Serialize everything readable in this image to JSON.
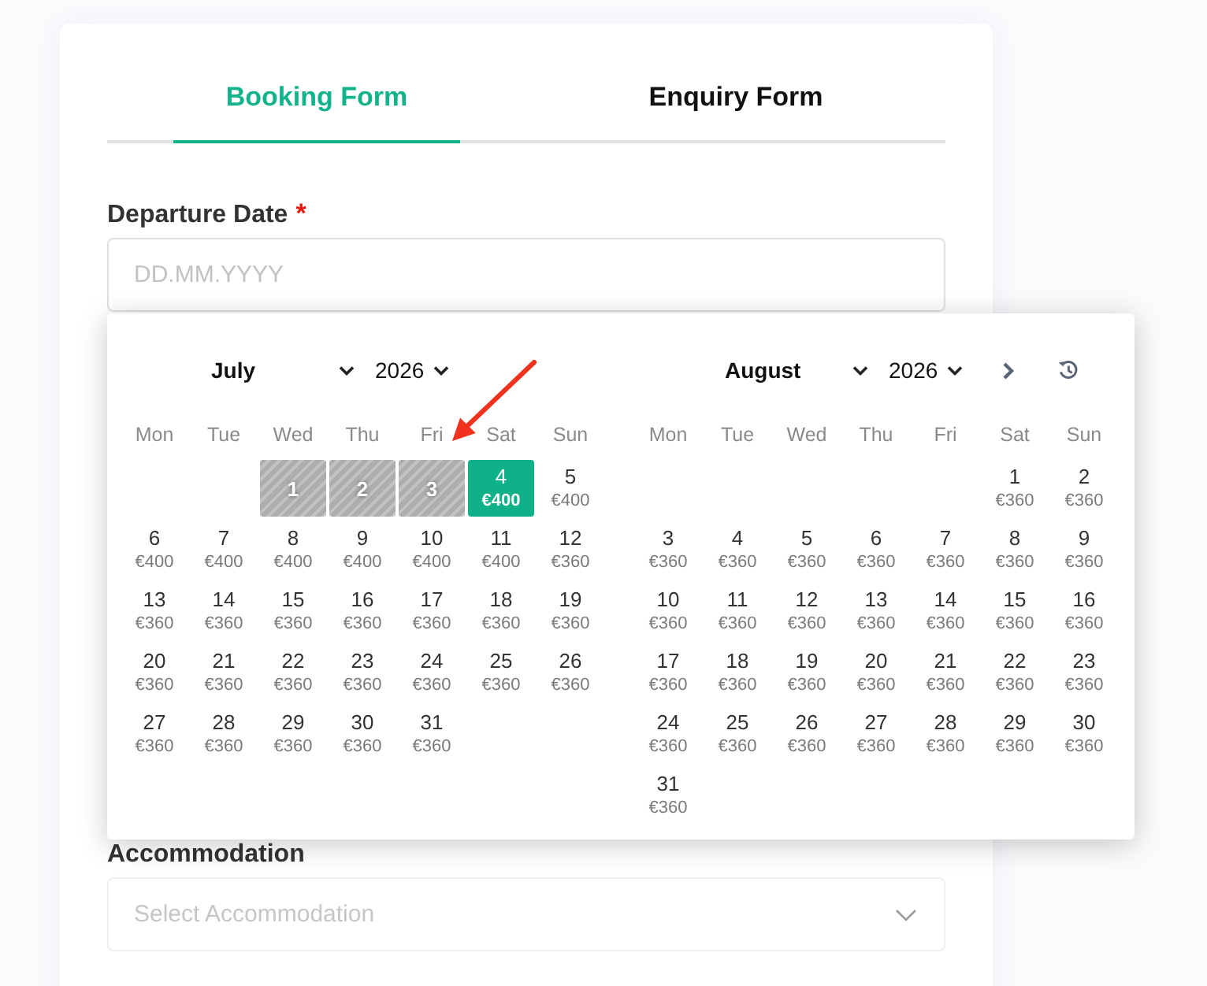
{
  "tabs": [
    {
      "label": "Booking Form",
      "selected": true
    },
    {
      "label": "Enquiry Form",
      "selected": false
    }
  ],
  "departure_date": {
    "label": "Departure Date",
    "required_mark": "*",
    "placeholder": "DD.MM.YYYY"
  },
  "calendar": {
    "months": [
      {
        "month": "July",
        "year": "2026",
        "weekdays": [
          "Mon",
          "Tue",
          "Wed",
          "Thu",
          "Fri",
          "Sat",
          "Sun"
        ],
        "weeks": [
          [
            {
              "day": "1",
              "selected": false,
              "disabled": true
            },
            {
              "day": "2",
              "selected": false,
              "disabled": true
            },
            {
              "day": "3",
              "selected": false,
              "disabled": true
            },
            {
              "day": "4",
              "price": "€400",
              "selected": true,
              "disabled": false
            },
            {
              "day": "5",
              "price": "€400",
              "selected": false,
              "disabled": false
            }
          ],
          [
            {
              "day": "6",
              "price": "€400",
              "selected": false,
              "disabled": false
            },
            {
              "day": "7",
              "price": "€400",
              "selected": false,
              "disabled": false
            },
            {
              "day": "8",
              "price": "€400",
              "selected": false,
              "disabled": false
            },
            {
              "day": "9",
              "price": "€400",
              "selected": false,
              "disabled": false
            },
            {
              "day": "10",
              "price": "€400",
              "selected": false,
              "disabled": false
            },
            {
              "day": "11",
              "price": "€400",
              "selected": false,
              "disabled": false
            },
            {
              "day": "12",
              "price": "€360",
              "selected": false,
              "disabled": false
            }
          ],
          [
            {
              "day": "13",
              "price": "€360",
              "selected": false,
              "disabled": false
            },
            {
              "day": "14",
              "price": "€360",
              "selected": false,
              "disabled": false
            },
            {
              "day": "15",
              "price": "€360",
              "selected": false,
              "disabled": false
            },
            {
              "day": "16",
              "price": "€360",
              "selected": false,
              "disabled": false
            },
            {
              "day": "17",
              "price": "€360",
              "selected": false,
              "disabled": false
            },
            {
              "day": "18",
              "price": "€360",
              "selected": false,
              "disabled": false
            },
            {
              "day": "19",
              "price": "€360",
              "selected": false,
              "disabled": false
            }
          ],
          [
            {
              "day": "20",
              "price": "€360",
              "selected": false,
              "disabled": false
            },
            {
              "day": "21",
              "price": "€360",
              "selected": false,
              "disabled": false
            },
            {
              "day": "22",
              "price": "€360",
              "selected": false,
              "disabled": false
            },
            {
              "day": "23",
              "price": "€360",
              "selected": false,
              "disabled": false
            },
            {
              "day": "24",
              "price": "€360",
              "selected": false,
              "disabled": false
            },
            {
              "day": "25",
              "price": "€360",
              "selected": false,
              "disabled": false
            },
            {
              "day": "26",
              "price": "€360",
              "selected": false,
              "disabled": false
            }
          ],
          [
            {
              "day": "27",
              "price": "€360",
              "selected": false,
              "disabled": false
            },
            {
              "day": "28",
              "price": "€360",
              "selected": false,
              "disabled": false
            },
            {
              "day": "29",
              "price": "€360",
              "selected": false,
              "disabled": false
            },
            {
              "day": "30",
              "price": "€360",
              "selected": false,
              "disabled": false
            },
            {
              "day": "31",
              "price": "€360",
              "selected": false,
              "disabled": false
            }
          ]
        ]
      },
      {
        "month": "August",
        "year": "2026",
        "weekdays": [
          "Mon",
          "Tue",
          "Wed",
          "Thu",
          "Fri",
          "Sat",
          "Sun"
        ],
        "weeks": [
          [
            {
              "day": "1",
              "price": "€360",
              "selected": false,
              "disabled": false
            },
            {
              "day": "2",
              "price": "€360",
              "selected": false,
              "disabled": false
            }
          ],
          [
            {
              "day": "3",
              "price": "€360",
              "selected": false,
              "disabled": false
            },
            {
              "day": "4",
              "price": "€360",
              "selected": false,
              "disabled": false
            },
            {
              "day": "5",
              "price": "€360",
              "selected": false,
              "disabled": false
            },
            {
              "day": "6",
              "price": "€360",
              "selected": false,
              "disabled": false
            },
            {
              "day": "7",
              "price": "€360",
              "selected": false,
              "disabled": false
            },
            {
              "day": "8",
              "price": "€360",
              "selected": false,
              "disabled": false
            },
            {
              "day": "9",
              "price": "€360",
              "selected": false,
              "disabled": false
            }
          ],
          [
            {
              "day": "10",
              "price": "€360",
              "selected": false,
              "disabled": false
            },
            {
              "day": "11",
              "price": "€360",
              "selected": false,
              "disabled": false
            },
            {
              "day": "12",
              "price": "€360",
              "selected": false,
              "disabled": false
            },
            {
              "day": "13",
              "price": "€360",
              "selected": false,
              "disabled": false
            },
            {
              "day": "14",
              "price": "€360",
              "selected": false,
              "disabled": false
            },
            {
              "day": "15",
              "price": "€360",
              "selected": false,
              "disabled": false
            },
            {
              "day": "16",
              "price": "€360",
              "selected": false,
              "disabled": false
            }
          ],
          [
            {
              "day": "17",
              "price": "€360",
              "selected": false,
              "disabled": false
            },
            {
              "day": "18",
              "price": "€360",
              "selected": false,
              "disabled": false
            },
            {
              "day": "19",
              "price": "€360",
              "selected": false,
              "disabled": false
            },
            {
              "day": "20",
              "price": "€360",
              "selected": false,
              "disabled": false
            },
            {
              "day": "21",
              "price": "€360",
              "selected": false,
              "disabled": false
            },
            {
              "day": "22",
              "price": "€360",
              "selected": false,
              "disabled": false
            },
            {
              "day": "23",
              "price": "€360",
              "selected": false,
              "disabled": false
            }
          ],
          [
            {
              "day": "24",
              "price": "€360",
              "selected": false,
              "disabled": false
            },
            {
              "day": "25",
              "price": "€360",
              "selected": false,
              "disabled": false
            },
            {
              "day": "26",
              "price": "€360",
              "selected": false,
              "disabled": false
            },
            {
              "day": "27",
              "price": "€360",
              "selected": false,
              "disabled": false
            },
            {
              "day": "28",
              "price": "€360",
              "selected": false,
              "disabled": false
            },
            {
              "day": "29",
              "price": "€360",
              "selected": false,
              "disabled": false
            },
            {
              "day": "30",
              "price": "€360",
              "selected": false,
              "disabled": false
            }
          ],
          [
            {
              "day": "31",
              "price": "€360",
              "selected": false,
              "disabled": false
            }
          ]
        ]
      }
    ]
  },
  "accommodation": {
    "label": "Accommodation",
    "placeholder": "Select Accommodation"
  }
}
